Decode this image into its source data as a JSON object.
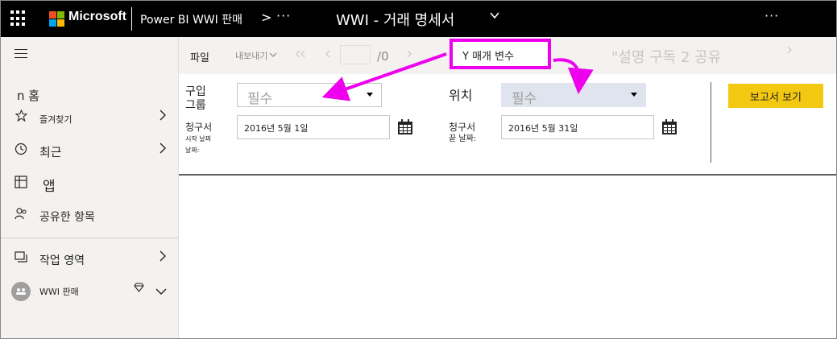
{
  "topbar": {
    "brand": "Microsoft",
    "workspace": "Power BI WWI 판매",
    "breadcrumb_separator": ">",
    "more": "···",
    "report_title": "WWI - 거래 명세서",
    "more_right": "···"
  },
  "nav": {
    "home": "n 홈",
    "favorites": "즐겨찾기",
    "recent": "최근",
    "apps": "앱",
    "shared": "공유한 항목",
    "workspaces": "작업 영역",
    "current_workspace": "WWI 판매"
  },
  "toolbar": {
    "file": "파일",
    "export": "내보내기",
    "page_total": "/0",
    "faded_actions": "\"설명 구독 2 공유"
  },
  "callout": {
    "text": "Y 매개 변수"
  },
  "params": {
    "buying_group_label_1": "구입",
    "buying_group_label_2": "그룹",
    "buying_group_placeholder": "필수",
    "location_label": "위치",
    "location_placeholder": "필수",
    "start_label_1": "청구서",
    "start_label_2": "시작 날짜",
    "start_label_3": "날짜:",
    "start_date": "2016년 5월 1일",
    "end_label_1": "청구서",
    "end_label_2": "끝 날짜:",
    "end_date": "2016년 5월 31일",
    "view_report": "보고서 보기"
  },
  "colors": {
    "accent_yellow": "#f2c811",
    "annotation_magenta": "#ee00ee",
    "topbar_bg": "#000000"
  }
}
